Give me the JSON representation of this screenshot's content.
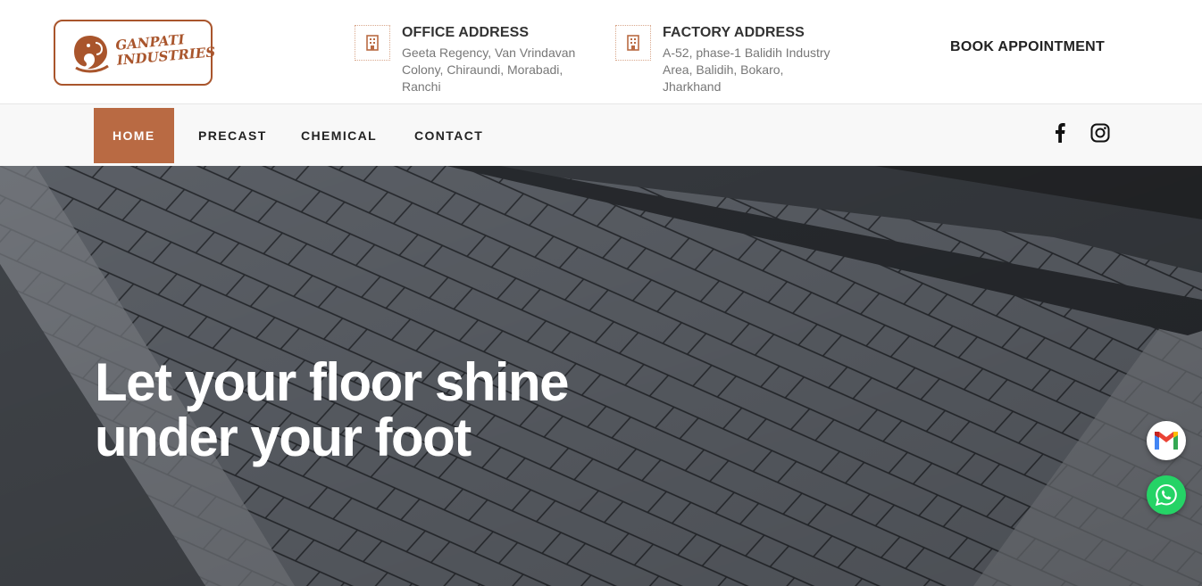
{
  "brand": {
    "line1": "GANPATI",
    "line2": "INDUSTRIES",
    "color": "#a9552c"
  },
  "office": {
    "title": "OFFICE ADDRESS",
    "lines": [
      "Geeta Regency, Van Vrindavan",
      "Colony, Chiraundi, Morabadi,",
      "Ranchi"
    ],
    "icon": "building-icon"
  },
  "factory": {
    "title": "FACTORY ADDRESS",
    "lines": [
      "A-52, phase-1 Balidih Industry",
      "Area, Balidih, Bokaro,",
      "Jharkhand"
    ],
    "icon": "building-icon"
  },
  "book_label": "BOOK APPOINTMENT",
  "nav": {
    "items": [
      "HOME",
      "PRECAST",
      "CHEMICAL",
      "CONTACT"
    ],
    "active": "HOME",
    "active_color": "#b96a43"
  },
  "social": [
    "facebook-icon",
    "instagram-icon"
  ],
  "hero": {
    "line1": "Let your floor shine",
    "line2": "under your foot"
  },
  "floating": [
    "gmail-icon",
    "whatsapp-icon"
  ],
  "colors": {
    "accent": "#b96a43",
    "whatsapp": "#25d366"
  }
}
